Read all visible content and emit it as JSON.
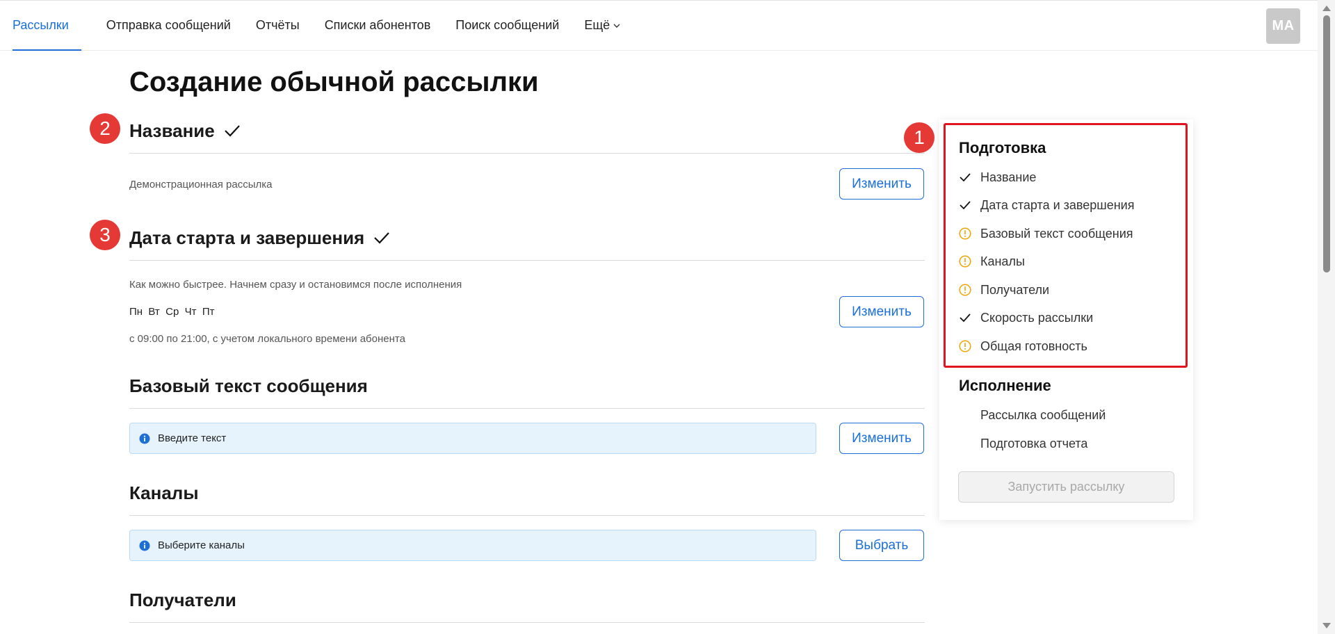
{
  "nav": {
    "items": [
      {
        "label": "Рассылки",
        "active": true
      },
      {
        "label": "Отправка сообщений"
      },
      {
        "label": "Отчёты"
      },
      {
        "label": "Списки абонентов"
      },
      {
        "label": "Поиск сообщений"
      },
      {
        "label": "Ещё",
        "has_dropdown": true
      }
    ],
    "avatar_initials": "MA"
  },
  "page": {
    "title": "Создание обычной рассылки"
  },
  "sections": {
    "name": {
      "title": "Название",
      "completed": true,
      "value": "Демонстрационная рассылка",
      "button": "Изменить",
      "badge": "2"
    },
    "dates": {
      "title": "Дата старта и завершения",
      "completed": true,
      "line1": "Как можно быстрее. Начнем сразу и остановимся после исполнения",
      "days": "Пн  Вт  Ср  Чт  Пт",
      "line3": "с 09:00 по 21:00, с учетом локального времени абонента",
      "button": "Изменить",
      "badge": "3"
    },
    "base_text": {
      "title": "Базовый текст сообщения",
      "info": "Введите текст",
      "button": "Изменить"
    },
    "channels": {
      "title": "Каналы",
      "info": "Выберите каналы",
      "button": "Выбрать"
    },
    "recipients": {
      "title": "Получатели"
    }
  },
  "panel": {
    "badge": "1",
    "preparation_title": "Подготовка",
    "preparation_items": [
      {
        "label": "Название",
        "status": "done"
      },
      {
        "label": "Дата старта и завершения",
        "status": "done"
      },
      {
        "label": "Базовый текст сообщения",
        "status": "warning"
      },
      {
        "label": "Каналы",
        "status": "warning"
      },
      {
        "label": "Получатели",
        "status": "warning"
      },
      {
        "label": "Скорость рассылки",
        "status": "done"
      },
      {
        "label": "Общая готовность",
        "status": "warning"
      }
    ],
    "execution_title": "Исполнение",
    "execution_items": [
      {
        "label": "Рассылка сообщений"
      },
      {
        "label": "Подготовка отчета"
      }
    ],
    "launch_button": "Запустить рассылку"
  },
  "colors": {
    "accent": "#1a6fd9",
    "warning": "#f0a500",
    "badge": "#e53935",
    "highlight": "#e0141e",
    "info_bg": "#e6f3fd"
  }
}
